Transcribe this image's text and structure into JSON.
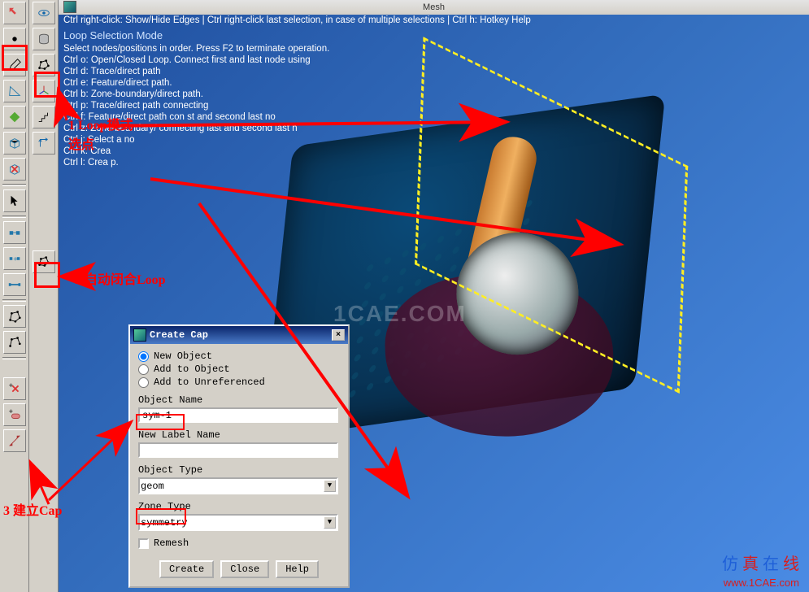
{
  "window": {
    "title": "Mesh"
  },
  "help": {
    "topline": "Ctrl right-click: Show/Hide Edges | Ctrl right-click last selection, in case of multiple selections | Ctrl h: Hotkey Help",
    "mode_title": "Loop Selection Mode",
    "lines": [
      "Select nodes/positions in order. Press F2 to terminate operation.",
      "Ctrl o: Open/Closed Loop. Connect first and last node using",
      "  Ctrl d: Trace/direct path",
      "  Ctrl e: Feature/direct path.",
      "  Ctrl b: Zone-boundary/direct path.",
      "  Ctrl p: Trace/direct path connecting",
      "  Ctrl f: Feature/direct path con               st and second last no",
      "  Ctrl z: Zone-boundary/                   connecting last and second last n",
      "  Ctrl j: Select a    no",
      "  Ctrl k: Crea",
      "  Ctrl l: Crea               p."
    ]
  },
  "annotations": {
    "a1": "1 Loop模式\n选点",
    "a2": "2 自动闭合Loop",
    "a3": "3 建立Cap"
  },
  "dialog": {
    "title": "Create Cap",
    "radio_new": "New Object",
    "radio_add": "Add to Object",
    "radio_unref": "Add to Unreferenced",
    "lbl_objname": "Object Name",
    "val_objname": "sym-1",
    "lbl_labelname": "New Label Name",
    "val_labelname": "",
    "lbl_objtype": "Object Type",
    "val_objtype": "geom",
    "lbl_zonetype": "Zone Type",
    "val_zonetype": "symmetry",
    "chk_remesh": "Remesh",
    "btn_create": "Create",
    "btn_close": "Close",
    "btn_help": "Help"
  },
  "watermark": {
    "center": "1CAE.COM",
    "brand": "仿 真 在 线",
    "url": "www.1CAE.com"
  },
  "toolbar1_icons": [
    "reset",
    "eye",
    "point",
    "box",
    "pencil",
    "loop",
    "tri",
    "axis",
    "diamond",
    "stairs",
    "cube",
    "lcs",
    "error",
    "cursor",
    "selrect",
    "selplus",
    "seledge",
    "poly",
    "polyopen",
    "spacer",
    "plus-cross",
    "plus-pill",
    "scale"
  ],
  "toolbar2_icons": [
    "app",
    "",
    "",
    "cyl",
    "",
    "",
    "",
    "",
    "stairs2",
    "",
    "",
    "",
    "",
    "",
    "",
    "",
    "",
    "",
    "",
    "",
    ""
  ]
}
